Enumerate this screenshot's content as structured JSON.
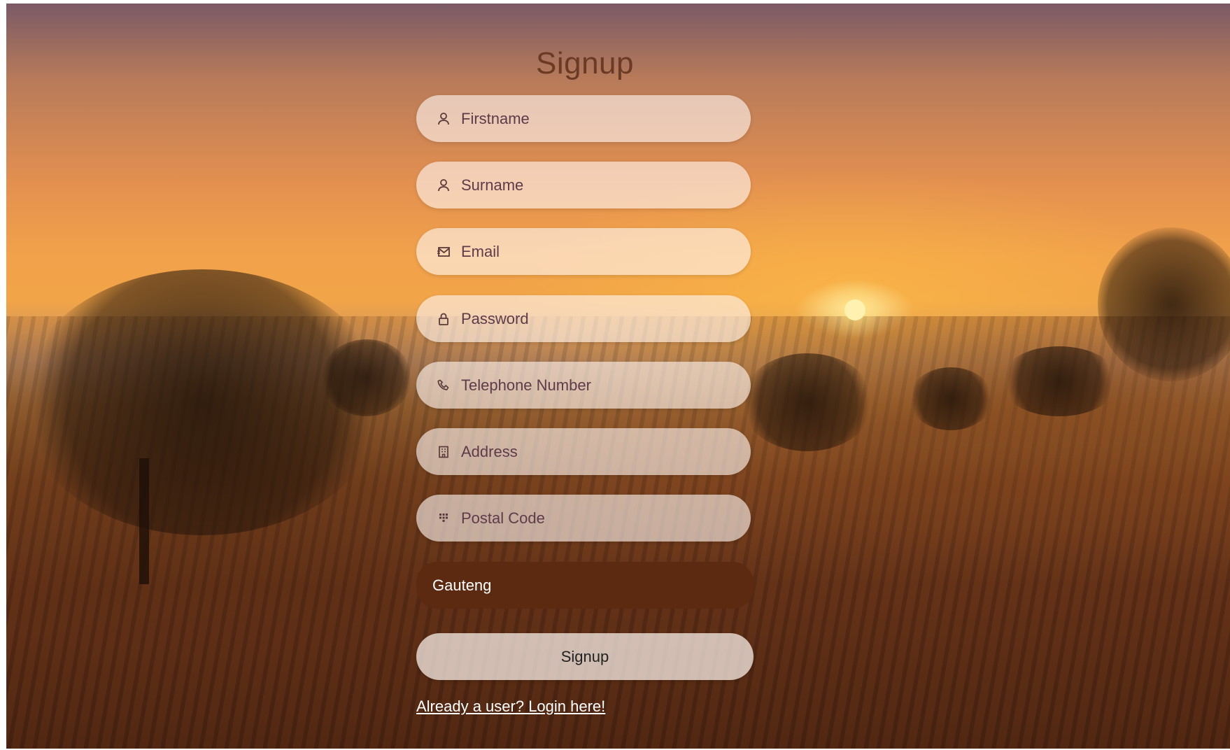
{
  "page": {
    "title": "Signup"
  },
  "form": {
    "fields": [
      {
        "placeholder": "Firstname",
        "icon": "user-icon"
      },
      {
        "placeholder": "Surname",
        "icon": "user-icon"
      },
      {
        "placeholder": "Email",
        "icon": "envelope-icon"
      },
      {
        "placeholder": "Password",
        "icon": "lock-icon"
      },
      {
        "placeholder": "Telephone Number",
        "icon": "phone-icon"
      },
      {
        "placeholder": "Address",
        "icon": "building-icon"
      },
      {
        "placeholder": "Postal Code",
        "icon": "grid-dots-icon"
      }
    ],
    "province": {
      "selected": "Gauteng"
    },
    "submit_label": "Signup",
    "login_link": "Already a user? Login here!"
  },
  "colors": {
    "province_bg": "#5c2a10",
    "title": "#6a3a25"
  }
}
